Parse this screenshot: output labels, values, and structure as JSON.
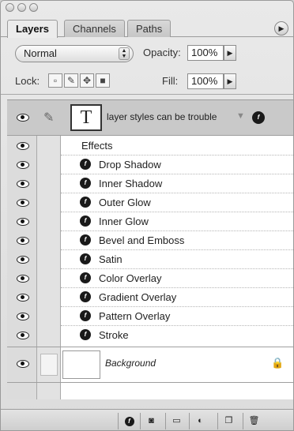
{
  "tabs": [
    {
      "label": "Layers",
      "active": true
    },
    {
      "label": "Channels",
      "active": false
    },
    {
      "label": "Paths",
      "active": false
    }
  ],
  "blend_mode": {
    "value": "Normal"
  },
  "opacity": {
    "label": "Opacity:",
    "value": "100%"
  },
  "lock": {
    "label": "Lock:"
  },
  "fill": {
    "label": "Fill:",
    "value": "100%"
  },
  "layers": {
    "type_layer": {
      "thumb_glyph": "T",
      "name": "layer styles can be trouble"
    },
    "effects_header": "Effects",
    "effects": [
      "Drop Shadow",
      "Inner Shadow",
      "Outer Glow",
      "Inner Glow",
      "Bevel and Emboss",
      "Satin",
      "Color Overlay",
      "Gradient Overlay",
      "Pattern Overlay",
      "Stroke"
    ],
    "background_layer": {
      "name": "Background"
    }
  },
  "icons": {
    "fx": "f",
    "menu": "▶",
    "stepper": "▲▼"
  }
}
